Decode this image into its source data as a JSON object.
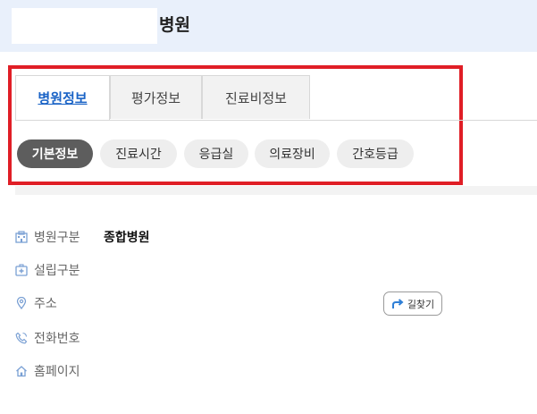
{
  "header": {
    "title": "병원"
  },
  "tabs": [
    {
      "label": "병원정보"
    },
    {
      "label": "평가정보"
    },
    {
      "label": "진료비정보"
    }
  ],
  "subtabs": [
    {
      "label": "기본정보"
    },
    {
      "label": "진료시간"
    },
    {
      "label": "응급실"
    },
    {
      "label": "의료장비"
    },
    {
      "label": "간호등급"
    }
  ],
  "info": {
    "type_label": "병원구분",
    "type_value": "종합병원",
    "founding_label": "설립구분",
    "address_label": "주소",
    "phone_label": "전화번호",
    "homepage_label": "홈페이지"
  },
  "directions": {
    "label": "길찾기"
  },
  "colors": {
    "header_bg": "#e9f0fb",
    "active_tab": "#1a63c6",
    "highlight_border": "#e01e26",
    "active_pill": "#5d5d5d",
    "icon": "#7aa0d4"
  },
  "icons": {
    "type": "hospital-building-icon",
    "founding": "medical-kit-icon",
    "address": "location-pin-icon",
    "phone": "phone-icon",
    "homepage": "home-icon",
    "directions": "turn-arrow-icon"
  }
}
